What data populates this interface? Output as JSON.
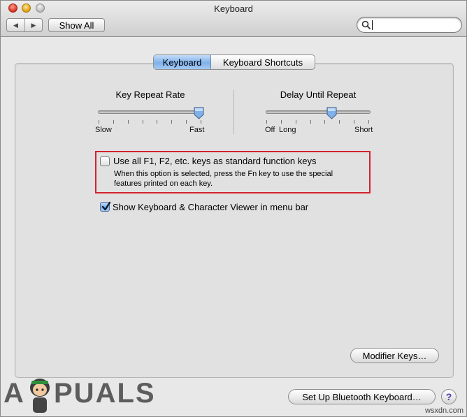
{
  "window": {
    "title": "Keyboard",
    "nav": {
      "back_glyph": "◀",
      "forward_glyph": "▶"
    },
    "show_all_label": "Show All",
    "search": {
      "value": "",
      "icon": "search-icon"
    }
  },
  "tabs": [
    {
      "label": "Keyboard",
      "selected": true
    },
    {
      "label": "Keyboard Shortcuts",
      "selected": false
    }
  ],
  "key_repeat": {
    "title": "Key Repeat Rate",
    "left_label": "Slow",
    "right_label": "Fast",
    "level": 1.0
  },
  "delay_repeat": {
    "title": "Delay Until Repeat",
    "label_off": "Off",
    "label_long": "Long",
    "label_short": "Short",
    "level": 0.64
  },
  "function_keys": {
    "label": "Use all F1, F2, etc. keys as standard function keys",
    "desc_line1": "When this option is selected, press the Fn key to use the special",
    "desc_line2": "features printed on each key.",
    "checked": false
  },
  "viewer": {
    "label": "Show Keyboard & Character Viewer in menu bar",
    "checked": true
  },
  "buttons": {
    "modifier_keys": "Modifier Keys…",
    "bluetooth": "Set Up Bluetooth Keyboard…",
    "help": "?"
  },
  "branding": {
    "logo_text_left": "A",
    "logo_text_right": "PUALS",
    "watermark": "wsxdn.com"
  },
  "colors": {
    "highlight_border": "#d3232f",
    "selected_tab": "#7fb1ea"
  }
}
